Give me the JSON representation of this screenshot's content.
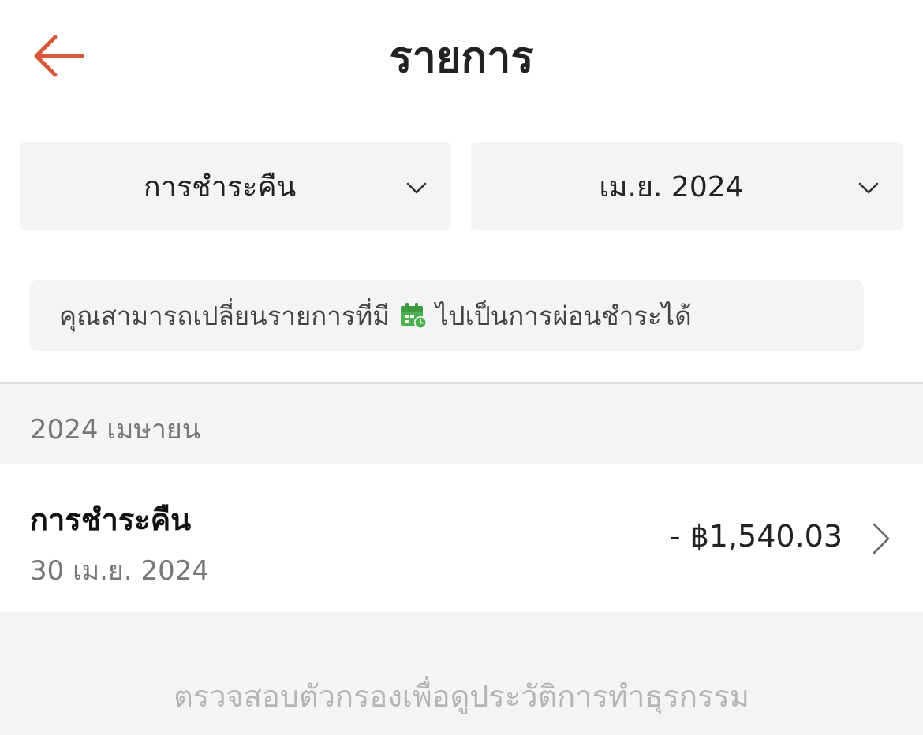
{
  "header": {
    "title": "รายการ",
    "back_icon": "arrow-left-icon",
    "accent_color": "#d9583b"
  },
  "filters": {
    "type": {
      "value": "การชำระคืน",
      "icon": "chevron-down-icon"
    },
    "month": {
      "value": "เม.ย. 2024",
      "icon": "chevron-down-icon"
    }
  },
  "info": {
    "text_before": "คุณสามารถเปลี่ยนรายการที่มี",
    "icon": "calendar-clock-icon",
    "icon_color": "#4caf50",
    "text_after": "ไปเป็นการผ่อนชำระได้"
  },
  "section": {
    "month_label": "2024 เมษายน"
  },
  "transactions": [
    {
      "name": "การชำระคืน",
      "date": "30 เม.ย. 2024",
      "amount": "- ฿1,540.03"
    }
  ],
  "footer": {
    "text": "ตรวจสอบตัวกรองเพื่อดูประวัติการทำธุรกรรม"
  }
}
